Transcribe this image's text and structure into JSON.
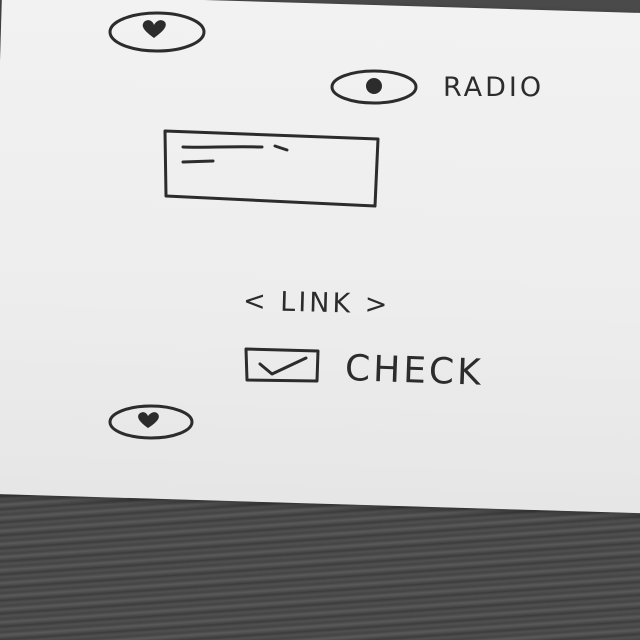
{
  "radio": {
    "label": "RADIO",
    "selected": true
  },
  "link": {
    "label": "< LINK >"
  },
  "checkbox": {
    "label": "CHECK",
    "checked": true
  },
  "icons": {
    "top": "heart-icon",
    "bottom": "heart-icon"
  },
  "colors": {
    "ink": "#2c2c2c",
    "paper": "#efefef",
    "table": "#4a4a4a"
  }
}
